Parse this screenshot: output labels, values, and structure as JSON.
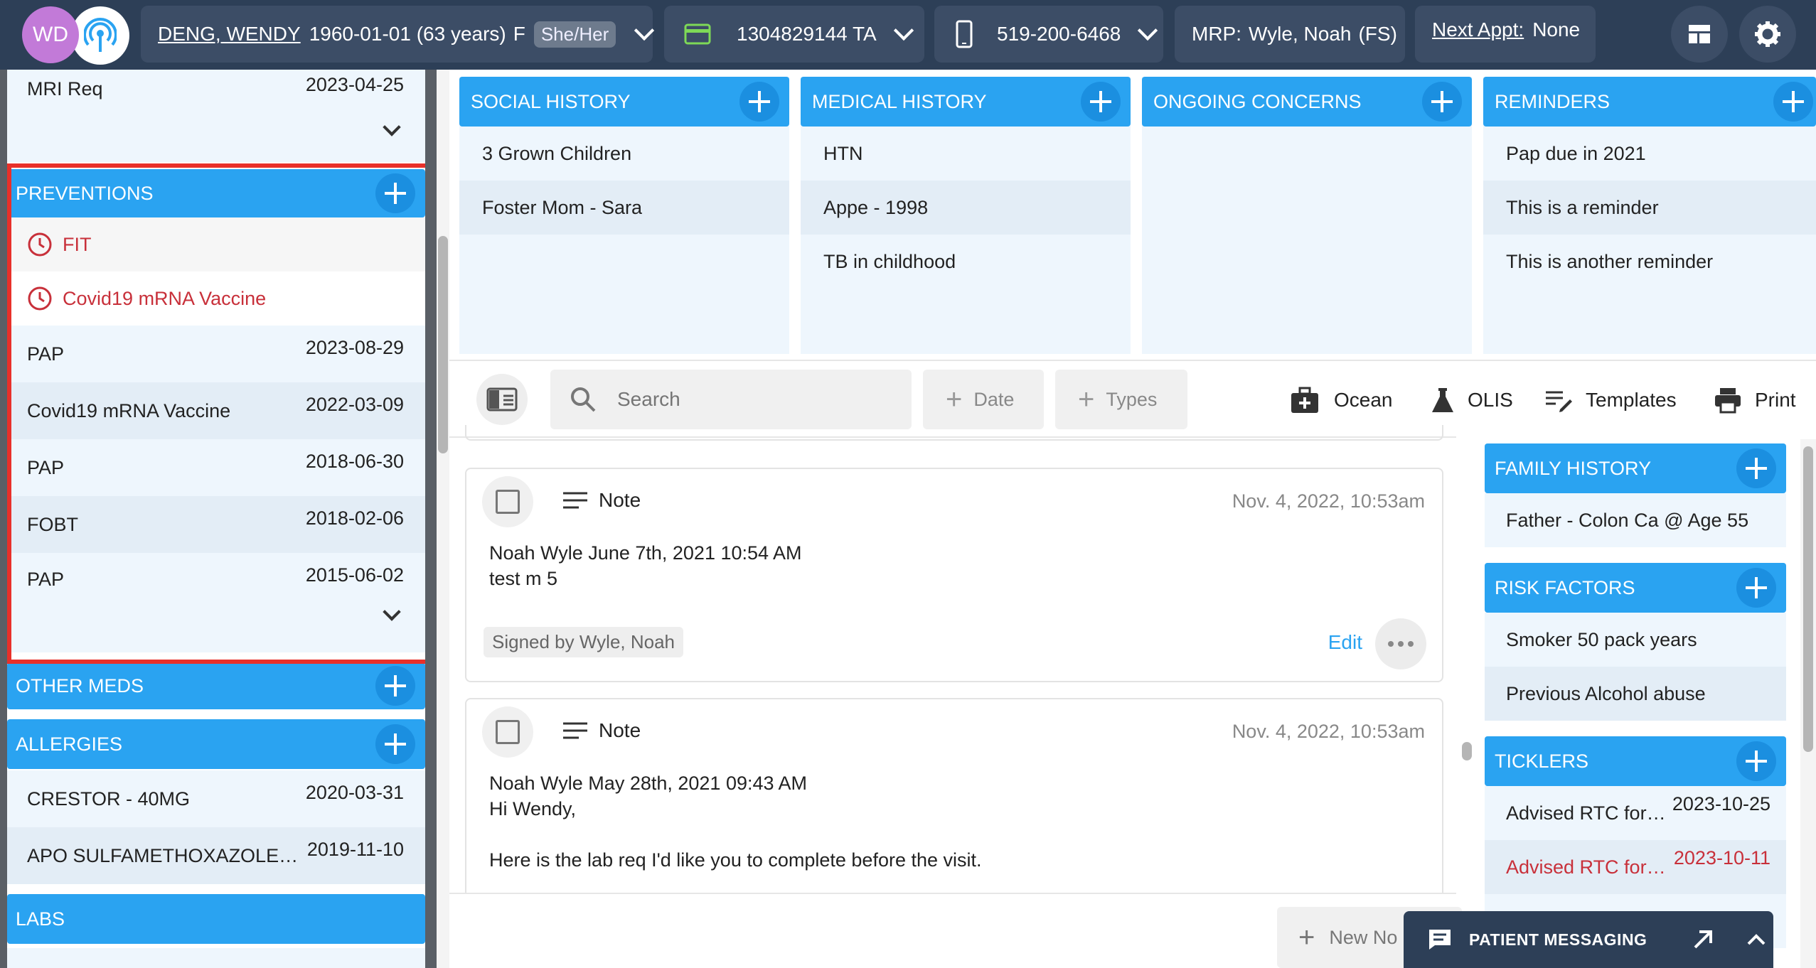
{
  "patient": {
    "initials": "WD",
    "name": "DENG, WENDY",
    "dob_age": "1960-01-01 (63 years)",
    "sex": "F",
    "pronouns": "She/Her",
    "health_card": "1304829144 TA",
    "phone": "519-200-6468",
    "mrp_label": "MRP:",
    "mrp_value": "Wyle, Noah",
    "mrp_suffix": "(FS)",
    "next_appt_label": "Next Appt:",
    "next_appt_value": "None"
  },
  "left": {
    "mri": {
      "label": "MRI Req",
      "date": "2023-04-25"
    },
    "preventions": {
      "title": "PREVENTIONS",
      "due": [
        {
          "label": "FIT"
        },
        {
          "label": "Covid19 mRNA Vaccine"
        }
      ],
      "items": [
        {
          "label": "PAP",
          "date": "2023-08-29"
        },
        {
          "label": "Covid19 mRNA Vaccine",
          "date": "2022-03-09"
        },
        {
          "label": "PAP",
          "date": "2018-06-30"
        },
        {
          "label": "FOBT",
          "date": "2018-02-06"
        },
        {
          "label": "PAP",
          "date": "2015-06-02"
        }
      ]
    },
    "other_meds": {
      "title": "OTHER MEDS"
    },
    "allergies": {
      "title": "ALLERGIES",
      "items": [
        {
          "label": "CRESTOR - 40MG",
          "date": "2020-03-31"
        },
        {
          "label": "APO SULFAMETHOXAZOLE…",
          "date": "2019-11-10"
        }
      ]
    },
    "labs": {
      "title": "LABS"
    }
  },
  "cards": {
    "social": {
      "title": "SOCIAL HISTORY",
      "items": [
        "3 Grown Children",
        "Foster Mom - Sara"
      ]
    },
    "medical": {
      "title": "MEDICAL HISTORY",
      "items": [
        "HTN",
        "Appe - 1998",
        "TB in childhood"
      ]
    },
    "concerns": {
      "title": "ONGOING CONCERNS",
      "items": []
    },
    "reminders": {
      "title": "REMINDERS",
      "items": [
        "Pap due in 2021",
        "This is a reminder",
        "This is another reminder"
      ]
    }
  },
  "toolbar": {
    "search_placeholder": "Search",
    "date_label": "Date",
    "types_label": "Types",
    "ocean_label": "Ocean",
    "olis_label": "OLIS",
    "templates_label": "Templates",
    "print_label": "Print"
  },
  "notes": [
    {
      "type": "Note",
      "date": "Nov. 4, 2022, 10:53am",
      "line1": "Noah Wyle June 7th, 2021 10:54 AM",
      "line2": "test m 5",
      "signed": "Signed by Wyle, Noah",
      "edit": "Edit"
    },
    {
      "type": "Note",
      "date": "Nov. 4, 2022, 10:53am",
      "line1": "Noah Wyle May 28th, 2021 09:43 AM",
      "line2": "Hi Wendy,",
      "line3": "Here is the lab req I'd like you to complete before the visit."
    }
  ],
  "new_note_label": "New No",
  "right": {
    "family": {
      "title": "FAMILY HISTORY",
      "items": [
        "Father - Colon Ca @ Age 55"
      ]
    },
    "risk": {
      "title": "RISK FACTORS",
      "items": [
        "Smoker 50 pack years",
        "Previous Alcohol abuse"
      ]
    },
    "ticklers": {
      "title": "TICKLERS",
      "items": [
        {
          "label": "Advised RTC for…",
          "date": "2023-10-25"
        },
        {
          "label": "Advised RTC for…",
          "date": "2023-10-11"
        }
      ]
    }
  },
  "messaging": {
    "label": "PATIENT MESSAGING"
  },
  "colors": {
    "accent": "#2aa3f1",
    "header": "#2d3f57",
    "overdue": "#c8303a",
    "annotation": "#e8302a"
  }
}
